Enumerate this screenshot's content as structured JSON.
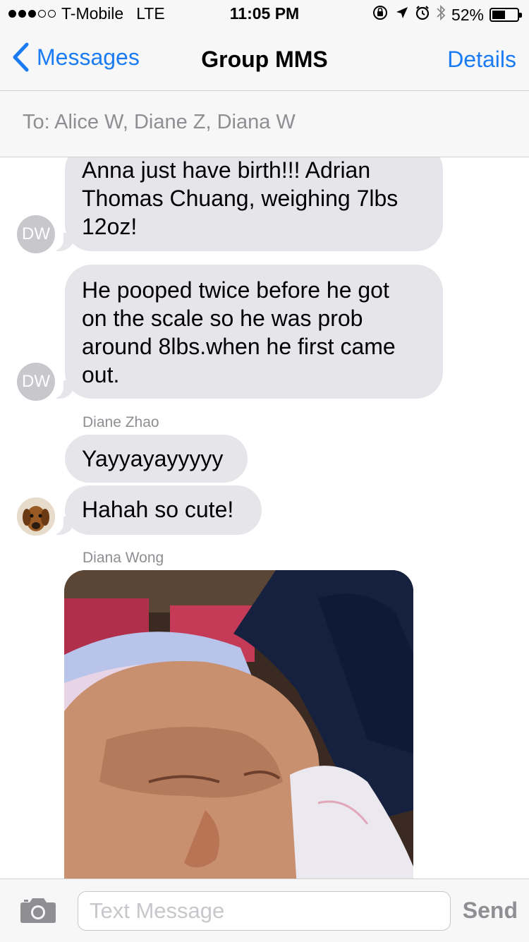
{
  "status_bar": {
    "carrier": "T-Mobile",
    "network": "LTE",
    "time": "11:05 PM",
    "battery": "52%",
    "battery_level": 0.52,
    "icons": [
      "orientation-lock-icon",
      "location-icon",
      "alarm-icon",
      "bluetooth-icon"
    ]
  },
  "nav": {
    "back_label": "Messages",
    "title": "Group MMS",
    "details_label": "Details"
  },
  "recipients": "To: Alice W, Diane Z, Diana W",
  "messages": [
    {
      "avatar": "DW",
      "text_lines": [
        "Anna just have birth!!! Adrian",
        "Thomas Chuang, weighing 7lbs",
        "12oz!"
      ]
    },
    {
      "avatar": "DW",
      "text_lines": [
        "He pooped twice before he got",
        "on the scale so he was prob",
        "around 8lbs.when he first came",
        "out."
      ]
    },
    {
      "sender": "Diane Zhao",
      "text": "Yayyayayyyyy"
    },
    {
      "text": "Hahah so cute!",
      "avatar": "dog-photo-avatar"
    },
    {
      "sender": "Diana Wong",
      "image": "newborn-baby-photo"
    }
  ],
  "input": {
    "placeholder": "Text Message",
    "send_label": "Send"
  },
  "colors": {
    "accent": "#1a7bf2",
    "bubble": "#e5e5ea",
    "muted": "#8e8e93"
  }
}
